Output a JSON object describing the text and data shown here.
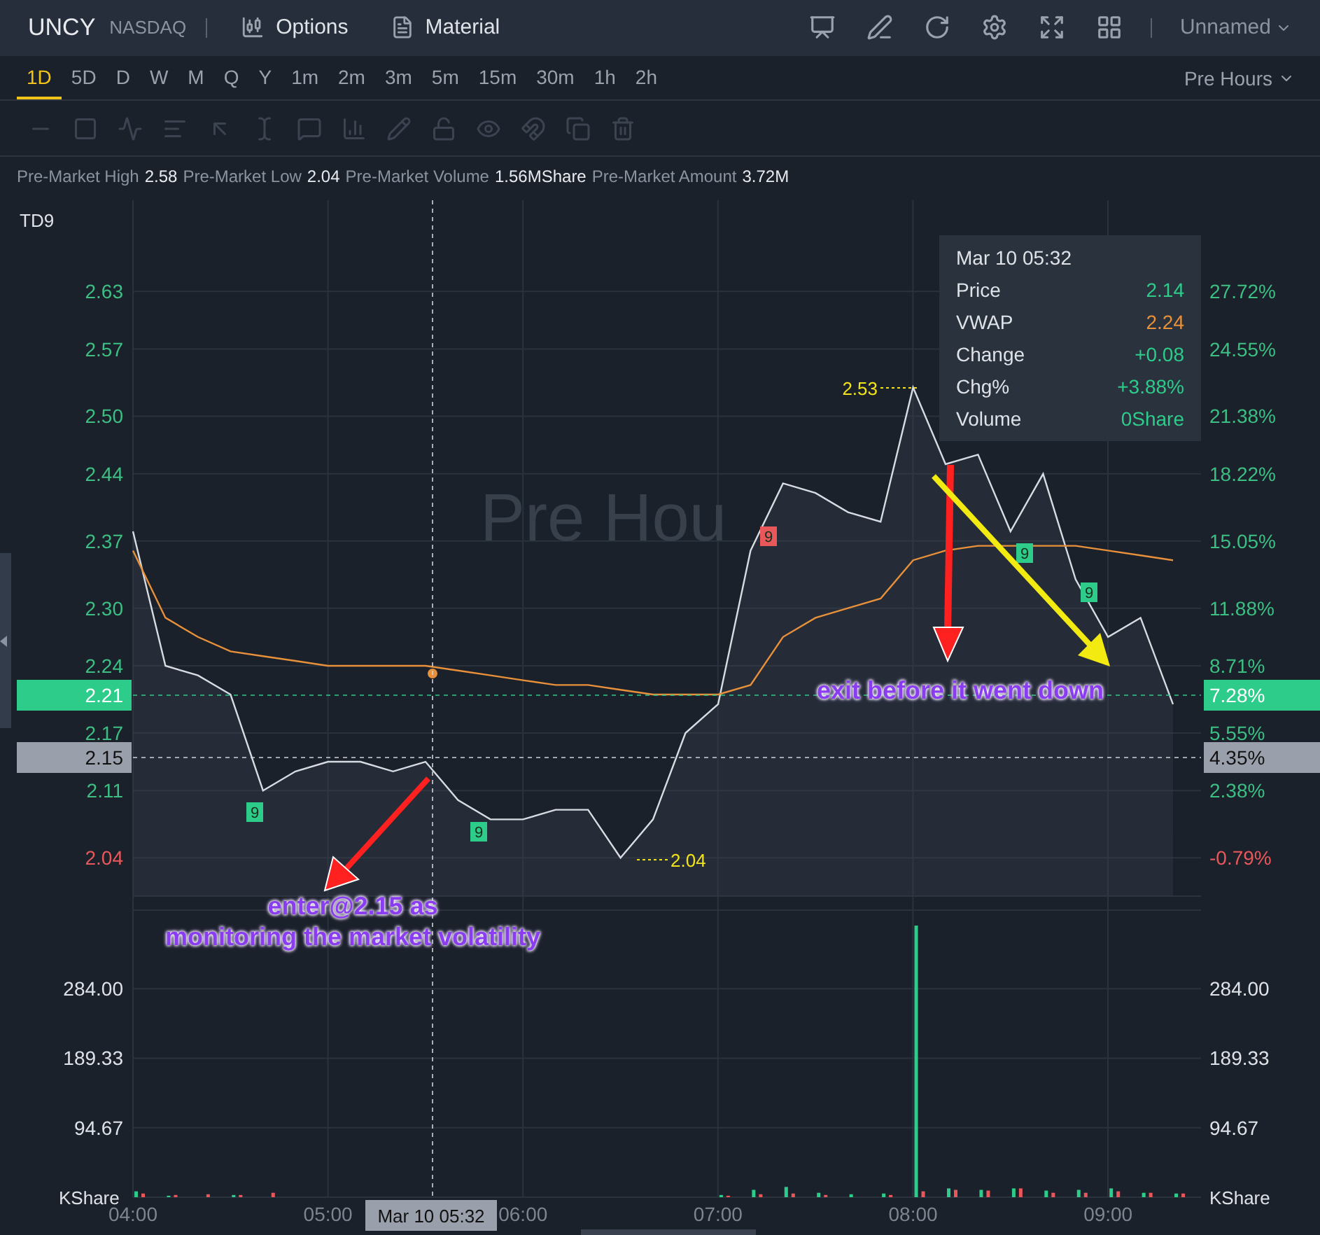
{
  "header": {
    "symbol": "UNCY",
    "exchange": "NASDAQ",
    "menu": [
      "Options",
      "Material"
    ],
    "layout_name": "Unnamed"
  },
  "timeframes": [
    {
      "label": "1D",
      "selected": true
    },
    {
      "label": "5D",
      "selected": false
    },
    {
      "label": "D",
      "selected": false
    },
    {
      "label": "W",
      "selected": false
    },
    {
      "label": "M",
      "selected": false
    },
    {
      "label": "Q",
      "selected": false
    },
    {
      "label": "Y",
      "selected": false
    },
    {
      "label": "1m",
      "selected": false
    },
    {
      "label": "2m",
      "selected": false
    },
    {
      "label": "3m",
      "selected": false
    },
    {
      "label": "5m",
      "selected": false
    },
    {
      "label": "15m",
      "selected": false
    },
    {
      "label": "30m",
      "selected": false
    },
    {
      "label": "1h",
      "selected": false
    },
    {
      "label": "2h",
      "selected": false
    }
  ],
  "session": "Pre Hours",
  "stats": [
    {
      "label": "Pre-Market High",
      "value": "2.58"
    },
    {
      "label": "Pre-Market Low",
      "value": "2.04"
    },
    {
      "label": "Pre-Market Volume",
      "value": "1.56MShare"
    },
    {
      "label": "Pre-Market Amount",
      "value": "3.72M"
    }
  ],
  "price_panel": {
    "indicator": "TD9",
    "background_label": "Pre Hou",
    "chart_data": {
      "type": "line",
      "grid": true,
      "categories": [
        null,
        null,
        null,
        null,
        null,
        null,
        null,
        null,
        null,
        null,
        null,
        null,
        null,
        null,
        null,
        null,
        null,
        null,
        null,
        null,
        null,
        null,
        null,
        null,
        null,
        null,
        null,
        null,
        null,
        null,
        null,
        null,
        null
      ],
      "series": [
        {
          "color": "#d8dce2",
          "values": [
            2.38,
            2.24,
            2.23,
            2.21,
            2.11,
            2.13,
            2.14,
            2.14,
            2.13,
            2.14,
            2.1,
            2.08,
            2.08,
            2.09,
            2.09,
            2.04,
            2.08,
            2.17,
            2.2,
            2.36,
            2.43,
            2.42,
            2.4,
            2.39,
            2.53,
            2.45,
            2.46,
            2.38,
            2.44,
            2.33,
            2.27,
            2.29,
            2.2
          ]
        },
        {
          "color": "#e8913a",
          "values": [
            2.36,
            2.29,
            2.27,
            2.255,
            2.25,
            2.245,
            2.24,
            2.24,
            2.24,
            2.24,
            2.235,
            2.23,
            2.225,
            2.22,
            2.22,
            2.215,
            2.21,
            2.21,
            2.21,
            2.22,
            2.27,
            2.29,
            2.3,
            2.31,
            2.35,
            2.36,
            2.365,
            2.365,
            2.365,
            2.365,
            2.36,
            2.355,
            2.35
          ]
        }
      ],
      "ylim": [
        2.0,
        2.725
      ],
      "yticks": [
        {
          "value": 2.63,
          "label": "2.63"
        },
        {
          "value": 2.57,
          "label": "2.57"
        },
        {
          "value": 2.5,
          "label": "2.50"
        },
        {
          "value": 2.44,
          "label": "2.44"
        },
        {
          "value": 2.37,
          "label": "2.37"
        },
        {
          "value": 2.3,
          "label": "2.30"
        },
        {
          "value": 2.24,
          "label": "2.24"
        },
        {
          "value": 2.17,
          "label": "2.17"
        },
        {
          "value": 2.11,
          "label": "2.11"
        },
        {
          "value": 2.04,
          "label": "2.04"
        }
      ]
    },
    "percent_axis": [
      {
        "label": "27.72%",
        "negative": false
      },
      {
        "label": "24.55%",
        "negative": false
      },
      {
        "label": "21.38%",
        "negative": false
      },
      {
        "label": "18.22%",
        "negative": false
      },
      {
        "label": "15.05%",
        "negative": false
      },
      {
        "label": "11.88%",
        "negative": false
      },
      {
        "label": "8.71%",
        "negative": false
      },
      {
        "label": "5.55%",
        "negative": false
      },
      {
        "label": "2.38%",
        "negative": false
      },
      {
        "label": "-0.79%",
        "negative": true
      }
    ],
    "price_tags": [
      {
        "kind": "current",
        "price": "2.21",
        "percent": "7.28%"
      },
      {
        "kind": "crosshair",
        "price": "2.15",
        "percent": "4.35%"
      }
    ],
    "extreme_labels": [
      {
        "kind": "high",
        "text": "2.53"
      },
      {
        "kind": "low",
        "text": "2.04"
      }
    ],
    "td9_markers": [
      {
        "text": "9",
        "color": "#2ecc8a"
      },
      {
        "text": "9",
        "color": "#2ecc8a"
      },
      {
        "text": "9",
        "color": "#e8585a"
      },
      {
        "text": "9",
        "color": "#2ecc8a"
      },
      {
        "text": "9",
        "color": "#2ecc8a"
      }
    ]
  },
  "tooltip": {
    "title": "Mar 10 05:32",
    "rows": [
      {
        "label": "Price",
        "value": "2.14",
        "color": "#2ecc8a"
      },
      {
        "label": "VWAP",
        "value": "2.24",
        "color": "#e8913a"
      },
      {
        "label": "Change",
        "value": "+0.08",
        "color": "#2ecc8a"
      },
      {
        "label": "Chg%",
        "value": "+3.88%",
        "color": "#2ecc8a"
      },
      {
        "label": "Volume",
        "value": "0Share",
        "color": "#2ecc8a"
      }
    ]
  },
  "notes": [
    {
      "lines": [
        "enter@2.15 as",
        "monitoring the market volatility"
      ]
    },
    {
      "lines": [
        "exit before it went down"
      ]
    }
  ],
  "volume_panel": {
    "crosshair_time": "Mar 10 05:32",
    "chart_data": {
      "type": "bar",
      "ylabel": "KShare",
      "y2label": "KShare",
      "stacked": false,
      "grid": true,
      "categories": [
        "04:00",
        null,
        null,
        null,
        null,
        null,
        "05:00",
        null,
        null,
        null,
        null,
        null,
        "06:00",
        null,
        null,
        null,
        null,
        null,
        "07:00",
        null,
        null,
        null,
        null,
        null,
        "08:00",
        null,
        null,
        null,
        null,
        null,
        "09:00",
        null,
        null
      ],
      "series": [
        {
          "color": "#2ecc8a",
          "values": [
            8,
            2,
            0,
            3,
            0,
            0,
            0,
            0,
            0,
            0,
            0,
            0,
            0,
            0,
            0,
            0,
            0,
            0,
            3,
            10,
            14,
            6,
            4,
            5,
            370,
            12,
            10,
            12,
            9,
            10,
            12,
            6,
            5
          ]
        },
        {
          "color": "#e8585a",
          "values": [
            5,
            3,
            4,
            3,
            6,
            0,
            0,
            0,
            0,
            0,
            0,
            0,
            0,
            0,
            0,
            0,
            0,
            0,
            2,
            4,
            5,
            3,
            0,
            3,
            8,
            10,
            9,
            12,
            6,
            6,
            8,
            6,
            5
          ]
        }
      ],
      "ylim": [
        0,
        391
      ],
      "yticks": [
        {
          "value": 284,
          "label": "284.00"
        },
        {
          "value": 189.33,
          "label": "189.33"
        },
        {
          "value": 94.67,
          "label": "94.67"
        }
      ],
      "y2lim": [
        0,
        391
      ],
      "y2ticks": [
        {
          "value": 284,
          "label": "284.00"
        },
        {
          "value": 189.33,
          "label": "189.33"
        },
        {
          "value": 94.67,
          "label": "94.67"
        }
      ]
    }
  }
}
